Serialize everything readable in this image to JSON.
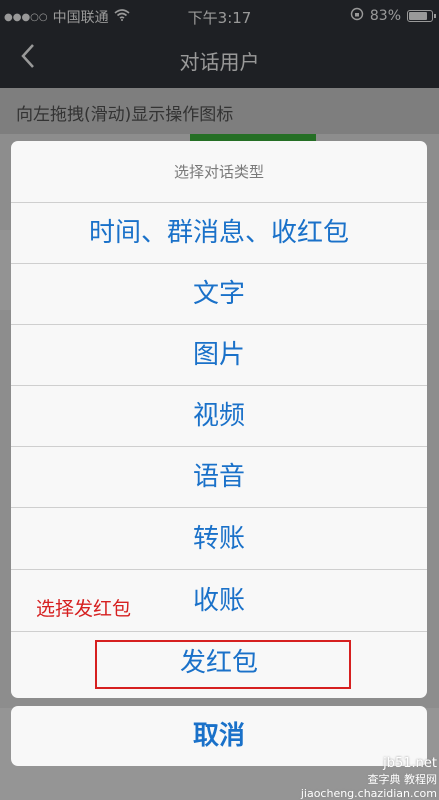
{
  "status_bar": {
    "carrier": "中国联通",
    "time": "下午3:17",
    "battery": "83%",
    "battery_level": 0.83
  },
  "nav": {
    "title": "对话用户"
  },
  "hint": "向左拖拽(滑动)显示操作图标",
  "action_sheet": {
    "title": "选择对话类型",
    "options": [
      "时间、群消息、收红包",
      "文字",
      "图片",
      "视频",
      "语音",
      "转账",
      "收账",
      "发红包"
    ],
    "cancel": "取消"
  },
  "annotation": {
    "label": "选择发红包",
    "color": "#d62020"
  },
  "watermark": {
    "line1": "查字典 教程网",
    "line2": "jiaocheng.chazidian.com",
    "site": "jb51.net"
  },
  "colors": {
    "accent": "#1a71c9",
    "nav_bg": "#32363c"
  }
}
